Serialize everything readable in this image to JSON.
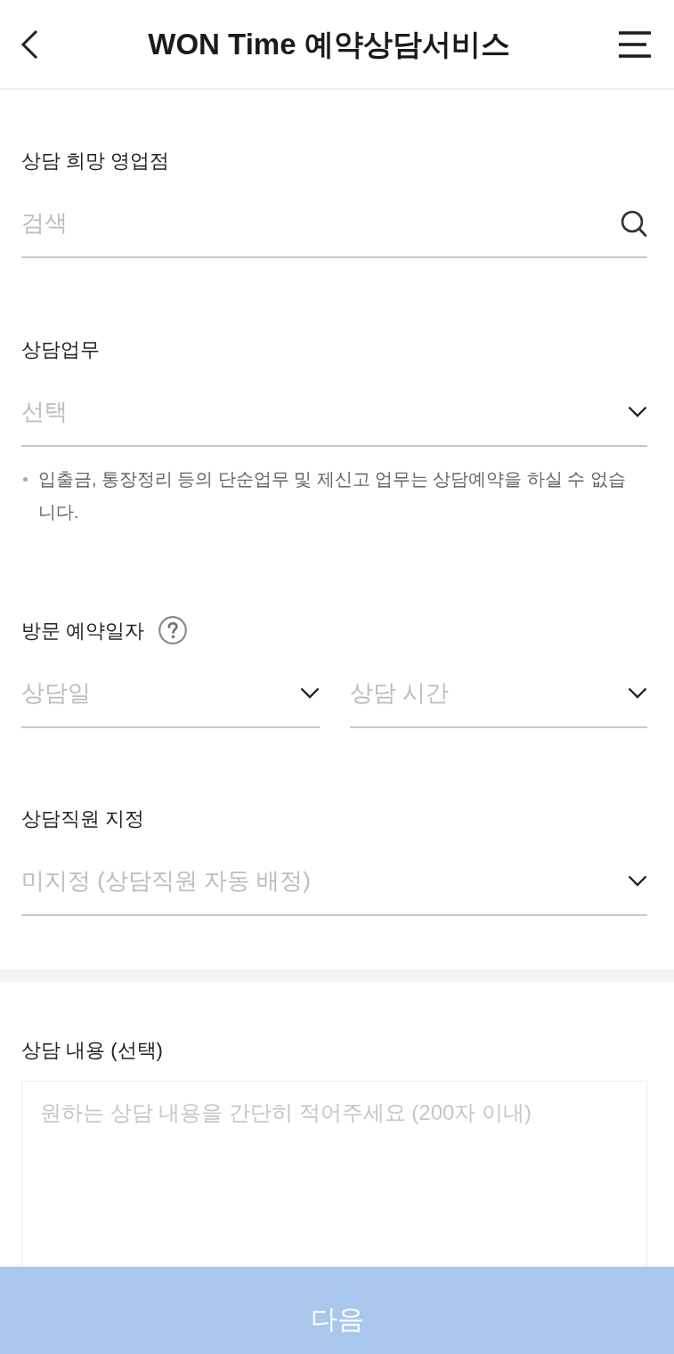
{
  "header": {
    "title": "WON Time 예약상담서비스"
  },
  "sections": [
    {
      "kind": "search",
      "label": "상담 희망 영업점",
      "placeholder": "검색"
    },
    {
      "kind": "select",
      "label": "상담업무",
      "placeholder": "선택",
      "notes": [
        "입출금, 통장정리 등의 단순업무 및 제신고 업무는 상담예약을 하실 수 없습니다."
      ]
    },
    {
      "kind": "select_pair",
      "label": "방문 예약일자",
      "help": true,
      "fields": [
        {
          "placeholder": "상담일"
        },
        {
          "placeholder": "상담 시간"
        }
      ]
    },
    {
      "kind": "select",
      "label": "상담직원 지정",
      "placeholder": "미지정 (상담직원 자동 배정)"
    }
  ],
  "details": {
    "label": "상담 내용 (선택)",
    "placeholder": "원하는 상담 내용을 간단히 적어주세요 (200자 이내)"
  },
  "next_button": {
    "label": "다음",
    "disabled": true
  }
}
